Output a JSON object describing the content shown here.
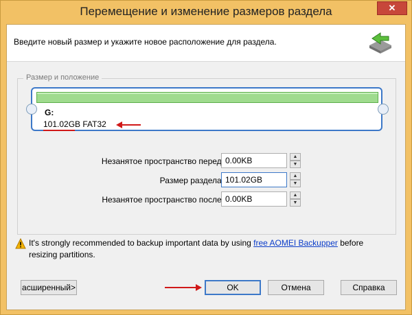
{
  "window": {
    "title": "Перемещение и изменение размеров раздела",
    "close_glyph": "✕"
  },
  "header": {
    "text": "Введите новый размер и укажите новое расположение для раздела.",
    "icon": "move-resize-arrow-icon"
  },
  "group": {
    "label": "Размер и положение",
    "partition": {
      "drive_letter": "G:",
      "info": "101.02GB FAT32",
      "bar_color": "#9fdb8e"
    }
  },
  "fields": [
    {
      "label": "Незанятое пространство перед:",
      "value": "0.00KB"
    },
    {
      "label": "Размер раздела:",
      "value": "101.02GB"
    },
    {
      "label": "Незанятое пространство после:",
      "value": "0.00KB"
    }
  ],
  "warning": {
    "text_before": "It's strongly recommended to backup important data by using ",
    "link": "free AOMEI Backupper",
    "text_after": " before resizing partitions."
  },
  "buttons": {
    "advanced": "асширенный>",
    "ok": "OK",
    "cancel": "Отмена",
    "help": "Справка"
  },
  "colors": {
    "accent": "#3c78c8",
    "annotation": "#d01818",
    "frame": "#f2c165"
  }
}
